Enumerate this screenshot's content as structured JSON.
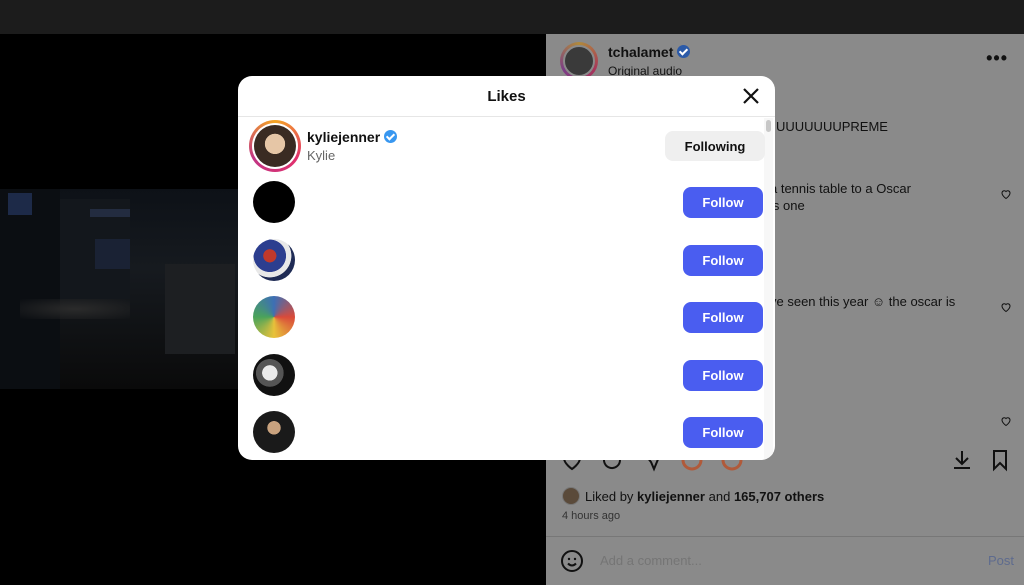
{
  "post": {
    "username": "tchalamet",
    "audio": "Original audio",
    "more": "•••",
    "comments": [
      "UUUUUUUPREME",
      "a tennis table to a Oscar",
      "is one",
      "ve seen this year ☺ the oscar is"
    ],
    "liked_by_prefix": "Liked by",
    "liked_by_user": "kyliejenner",
    "liked_by_and": "and",
    "liked_by_others": "165,707 others",
    "time_ago": "4 hours ago",
    "comment_placeholder": "Add a comment...",
    "post_label": "Post"
  },
  "modal": {
    "title": "Likes",
    "likers": [
      {
        "username": "kyliejenner",
        "name": "Kylie",
        "verified": true,
        "button": "Following"
      },
      {
        "username": "",
        "name": "",
        "verified": false,
        "button": "Follow"
      },
      {
        "username": "",
        "name": "",
        "verified": false,
        "button": "Follow"
      },
      {
        "username": "",
        "name": "",
        "verified": false,
        "button": "Follow"
      },
      {
        "username": "",
        "name": "",
        "verified": false,
        "button": "Follow"
      },
      {
        "username": "",
        "name": "",
        "verified": false,
        "button": "Follow"
      }
    ]
  },
  "colors": {
    "follow_button": "#4a5df0",
    "following_button": "#efefef",
    "verified": "#3897f0",
    "overlay_panel": "#8a8a8a"
  },
  "icons": [
    "close-icon",
    "verified-icon",
    "heart-icon",
    "comment-icon",
    "share-icon",
    "save-icon",
    "download-icon",
    "emoji-icon",
    "more-icon"
  ]
}
